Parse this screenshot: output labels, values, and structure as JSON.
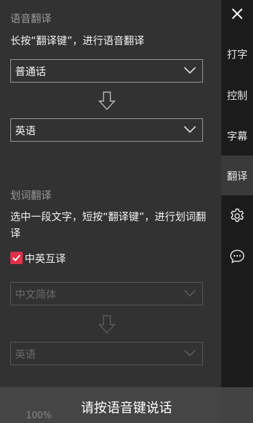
{
  "rail": {
    "items": [
      {
        "label": "打字"
      },
      {
        "label": "控制"
      },
      {
        "label": "字幕"
      },
      {
        "label": "翻译"
      }
    ],
    "icons": [
      "close-icon",
      "gear-icon",
      "chat-icon"
    ]
  },
  "voice": {
    "title": "语音翻译",
    "desc": "长按“翻译键”，进行语音翻译",
    "from": "普通话",
    "to": "英语"
  },
  "word": {
    "title": "划词翻译",
    "desc": "选中一段文字，短按“翻译键”，进行划词翻译",
    "checkbox_label": "中英互译",
    "checked": true,
    "from": "中文简体",
    "to": "英语"
  },
  "bottom": {
    "prompt": "请按语音键说话",
    "zoom": "100%"
  },
  "colors": {
    "accent": "#e0304a",
    "panel": "#323232",
    "rail": "#1b1b1b"
  }
}
